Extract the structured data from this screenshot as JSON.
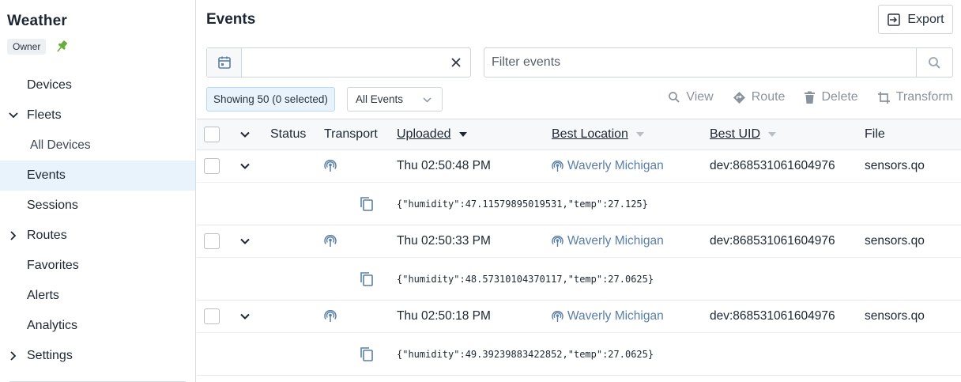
{
  "sidebar": {
    "app_title": "Weather",
    "role_badge": "Owner",
    "nav": [
      {
        "label": "Devices"
      },
      {
        "label": "Fleets"
      },
      {
        "label": "All Devices"
      },
      {
        "label": "Events"
      },
      {
        "label": "Sessions"
      },
      {
        "label": "Routes"
      },
      {
        "label": "Favorites"
      },
      {
        "label": "Alerts"
      },
      {
        "label": "Analytics"
      },
      {
        "label": "Settings"
      }
    ],
    "active_item": "Events"
  },
  "header": {
    "title": "Events",
    "export_label": "Export"
  },
  "filters": {
    "date_value": "",
    "filter_placeholder": "Filter events",
    "showing_text": "Showing 50 (0 selected)",
    "event_type_selected": "All Events"
  },
  "actions": {
    "view": "View",
    "route": "Route",
    "delete": "Delete",
    "transform": "Transform"
  },
  "table": {
    "columns": {
      "status": "Status",
      "transport": "Transport",
      "uploaded": "Uploaded",
      "best_location": "Best Location",
      "best_uid": "Best UID",
      "file": "File"
    },
    "rows": [
      {
        "uploaded": "Thu 02:50:48 PM",
        "location": "Waverly Michigan",
        "uid": "dev:868531061604976",
        "file": "sensors.qo",
        "body": "{\"humidity\":47.11579895019531,\"temp\":27.125}"
      },
      {
        "uploaded": "Thu 02:50:33 PM",
        "location": "Waverly Michigan",
        "uid": "dev:868531061604976",
        "file": "sensors.qo",
        "body": "{\"humidity\":48.57310104370117,\"temp\":27.0625}"
      },
      {
        "uploaded": "Thu 02:50:18 PM",
        "location": "Waverly Michigan",
        "uid": "dev:868531061604976",
        "file": "sensors.qo",
        "body": "{\"humidity\":49.39239883422852,\"temp\":27.0625}"
      }
    ]
  },
  "colors": {
    "accent": "#5a7fa6",
    "active_bg": "#e9f3fb",
    "pin": "#6aae3a"
  }
}
